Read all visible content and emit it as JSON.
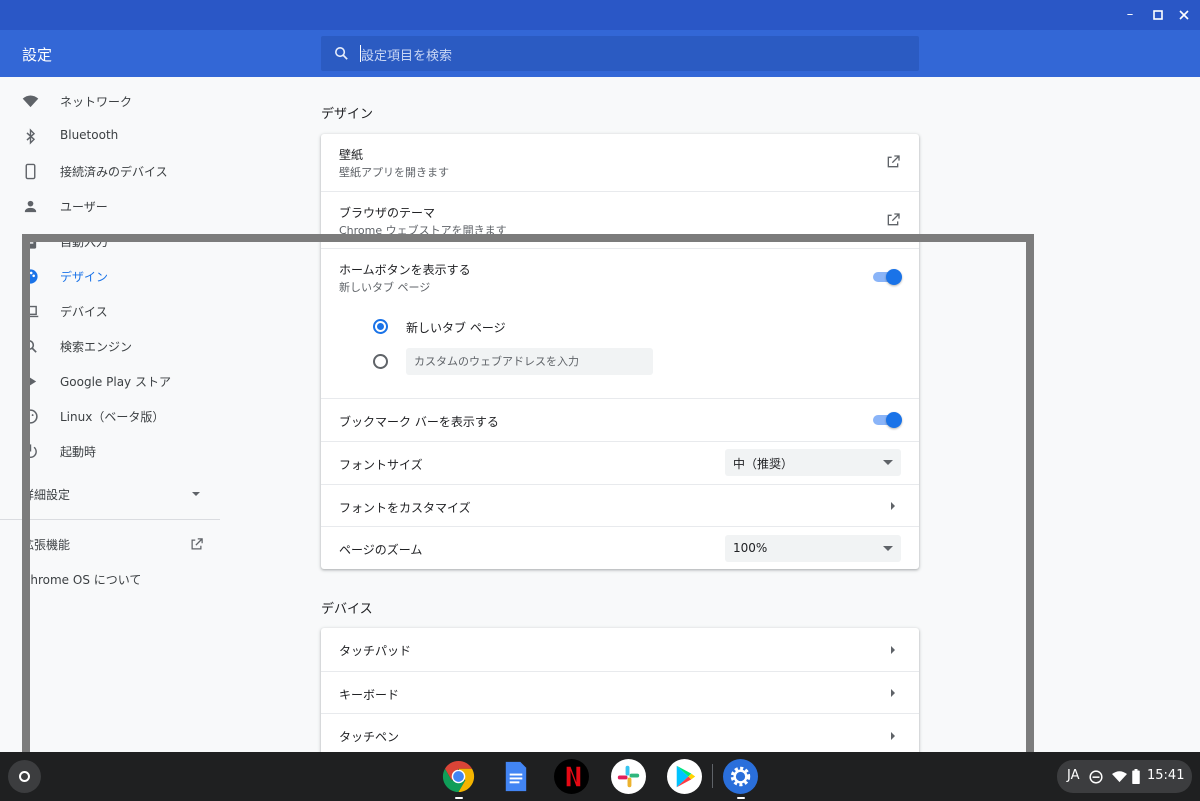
{
  "header": {
    "title": "設定",
    "search_placeholder": "設定項目を検索"
  },
  "sidebar": {
    "items": [
      {
        "label": "ネットワーク",
        "icon": "wifi-icon"
      },
      {
        "label": "Bluetooth",
        "icon": "bluetooth-icon"
      },
      {
        "label": "接続済みのデバイス",
        "icon": "phone-icon"
      },
      {
        "label": "ユーザー",
        "icon": "person-icon"
      },
      {
        "label": "自動入力",
        "icon": "clipboard-icon"
      },
      {
        "label": "デザイン",
        "icon": "palette-icon",
        "active": true
      },
      {
        "label": "デバイス",
        "icon": "laptop-icon"
      },
      {
        "label": "検索エンジン",
        "icon": "search-icon"
      },
      {
        "label": "Google Play ストア",
        "icon": "play-store-icon"
      },
      {
        "label": "Linux（ベータ版）",
        "icon": "linux-icon"
      },
      {
        "label": "起動時",
        "icon": "power-icon"
      }
    ],
    "advanced": "詳細設定",
    "extensions": "拡張機能",
    "about": "Chrome OS について"
  },
  "design": {
    "title": "デザイン",
    "wallpaper": {
      "label": "壁紙",
      "sub": "壁紙アプリを開きます"
    },
    "browser_theme": {
      "label": "ブラウザのテーマ",
      "sub": "Chrome ウェブストアを開きます"
    },
    "home_button": {
      "label": "ホームボタンを表示する",
      "sub": "新しいタブ ページ",
      "enabled": true
    },
    "radio_new_tab": "新しいタブ ページ",
    "custom_url_placeholder": "カスタムのウェブアドレスを入力",
    "bookmark_bar": {
      "label": "ブックマーク バーを表示する",
      "enabled": true
    },
    "font_size": {
      "label": "フォントサイズ",
      "value": "中（推奨）"
    },
    "customize_fonts": "フォントをカスタマイズ",
    "page_zoom": {
      "label": "ページのズーム",
      "value": "100%"
    }
  },
  "devices": {
    "title": "デバイス",
    "touchpad": "タッチパッド",
    "keyboard": "キーボード",
    "stylus": "タッチペン"
  },
  "shelf": {
    "apps": [
      "chrome",
      "docs",
      "netflix",
      "slack",
      "play-store",
      "settings"
    ],
    "ime": "JA",
    "time": "15:41"
  },
  "colors": {
    "accent": "#1a73e8",
    "header": "#3367d6"
  }
}
